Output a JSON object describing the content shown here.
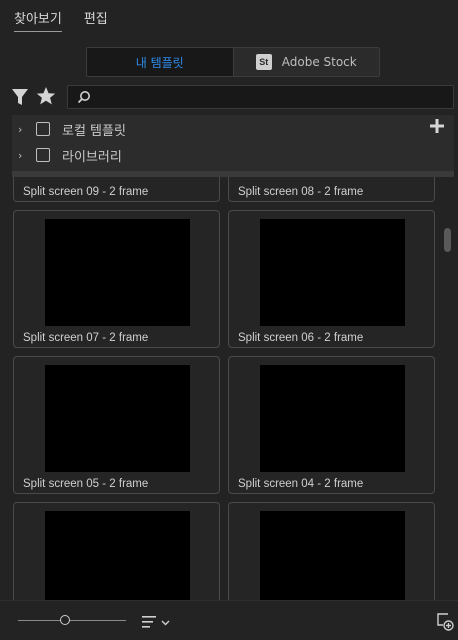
{
  "tabs": [
    {
      "label": "찾아보기",
      "active": true
    },
    {
      "label": "편집",
      "active": false
    }
  ],
  "source_toggle": {
    "my_templates": "내 템플릿",
    "stock_badge": "St",
    "stock": "Adobe Stock"
  },
  "search": {
    "placeholder": "",
    "value": ""
  },
  "libraries": [
    {
      "label": "로컬 템플릿"
    },
    {
      "label": "라이브러리"
    }
  ],
  "cards": [
    {
      "caption": "Split screen 09 - 2 frame"
    },
    {
      "caption": "Split screen 08 - 2 frame"
    },
    {
      "caption": "Split screen 07 - 2 frame"
    },
    {
      "caption": "Split screen 06 - 2 frame"
    },
    {
      "caption": "Split screen 05 - 2 frame"
    },
    {
      "caption": "Split screen 04 - 2 frame"
    },
    {
      "caption": ""
    },
    {
      "caption": ""
    }
  ],
  "icons": {
    "filter": "filter-icon",
    "favorite": "star-icon",
    "search": "search-icon",
    "add": "plus-icon",
    "sort": "sort-icon",
    "new": "new-item-icon"
  },
  "colors": {
    "accent": "#2d8ceb",
    "background": "#232323",
    "thumbnail": "#000000"
  }
}
